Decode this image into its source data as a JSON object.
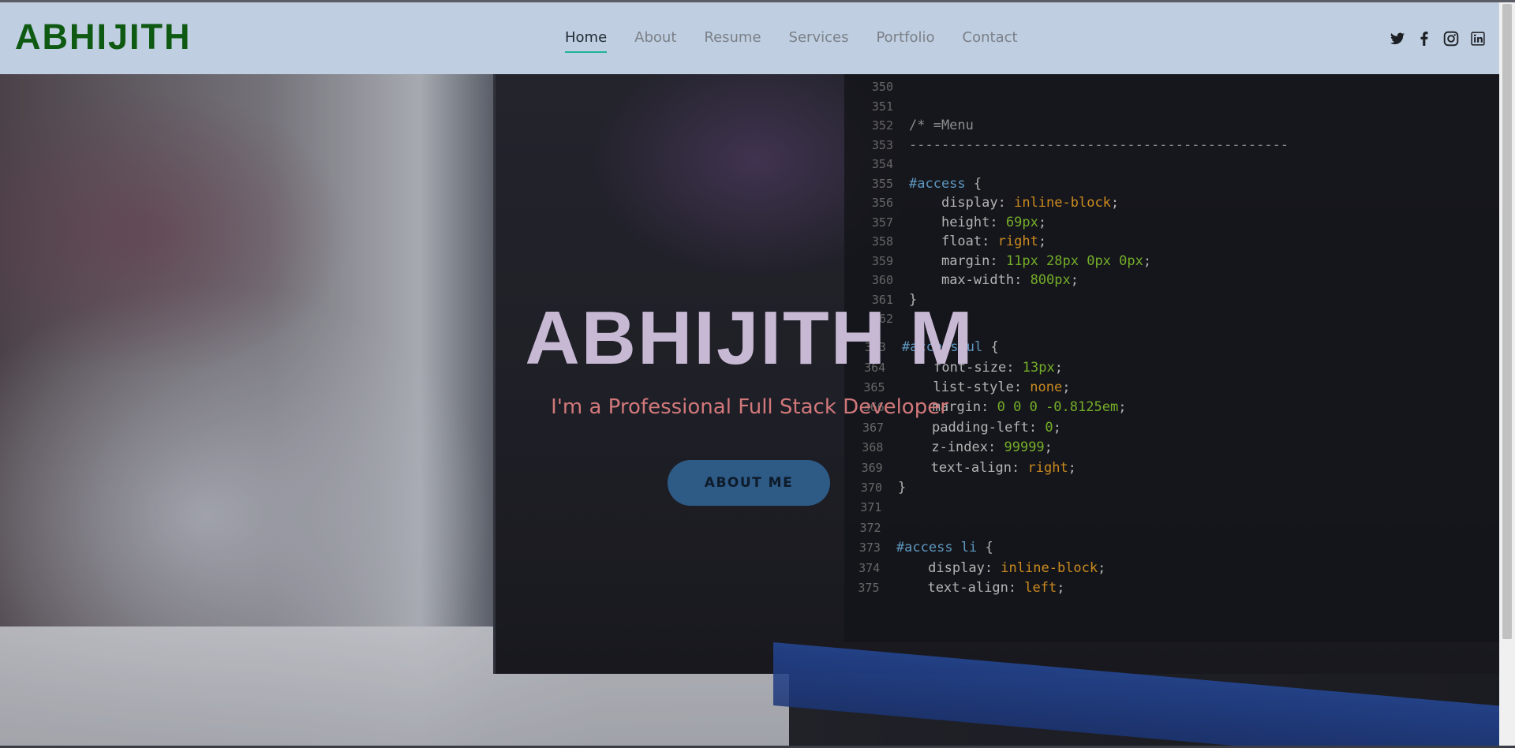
{
  "header": {
    "logo": "ABHIJITH",
    "nav": [
      {
        "label": "Home",
        "active": true
      },
      {
        "label": "About",
        "active": false
      },
      {
        "label": "Resume",
        "active": false
      },
      {
        "label": "Services",
        "active": false
      },
      {
        "label": "Portfolio",
        "active": false
      },
      {
        "label": "Contact",
        "active": false
      }
    ],
    "social_icons": [
      "twitter-icon",
      "facebook-icon",
      "instagram-icon",
      "linkedin-icon"
    ]
  },
  "hero": {
    "title": "ABHIJITH M",
    "subtitle": "I'm a Professional Full Stack Developer",
    "button_label": "ABOUT ME"
  },
  "colors": {
    "header_bg": "#bfcee0",
    "logo": "#0f5a12",
    "nav_active_underline": "#1fb39a",
    "hero_title": "#c7b8d4",
    "hero_subtitle": "#d1787a",
    "button_bg": "#2e5a86"
  },
  "background_code": {
    "lines": [
      {
        "n": "350",
        "html": ""
      },
      {
        "n": "351",
        "html": ""
      },
      {
        "n": "352",
        "html": "<span class='cmt'>/* =Menu</span>"
      },
      {
        "n": "353",
        "html": "<span class='cmt'>-----------------------------------------------</span>"
      },
      {
        "n": "354",
        "html": ""
      },
      {
        "n": "355",
        "html": "<span class='sel'>#access</span> {"
      },
      {
        "n": "356",
        "html": "&nbsp;&nbsp;&nbsp;&nbsp;<span class='prop'>display</span>: <span class='val-o'>inline-block</span>;"
      },
      {
        "n": "357",
        "html": "&nbsp;&nbsp;&nbsp;&nbsp;<span class='prop'>height</span>: <span class='val-g'>69px</span>;"
      },
      {
        "n": "358",
        "html": "&nbsp;&nbsp;&nbsp;&nbsp;<span class='prop'>float</span>: <span class='val-o'>right</span>;"
      },
      {
        "n": "359",
        "html": "&nbsp;&nbsp;&nbsp;&nbsp;<span class='prop'>margin</span>: <span class='val-g'>11px 28px 0px 0px</span>;"
      },
      {
        "n": "360",
        "html": "&nbsp;&nbsp;&nbsp;&nbsp;<span class='prop'>max-width</span>: <span class='val-g'>800px</span>;"
      },
      {
        "n": "361",
        "html": "}"
      },
      {
        "n": "362",
        "html": ""
      },
      {
        "n": "363",
        "html": "<span class='sel'>#access ul</span> {"
      },
      {
        "n": "364",
        "html": "&nbsp;&nbsp;&nbsp;&nbsp;<span class='prop'>font-size</span>: <span class='val-g'>13px</span>;"
      },
      {
        "n": "365",
        "html": "&nbsp;&nbsp;&nbsp;&nbsp;<span class='prop'>list-style</span>: <span class='val-o'>none</span>;"
      },
      {
        "n": "366",
        "html": "&nbsp;&nbsp;&nbsp;&nbsp;<span class='prop'>margin</span>: <span class='val-g'>0 0 0 -0.8125em</span>;"
      },
      {
        "n": "367",
        "html": "&nbsp;&nbsp;&nbsp;&nbsp;<span class='prop'>padding-left</span>: <span class='val-g'>0</span>;"
      },
      {
        "n": "368",
        "html": "&nbsp;&nbsp;&nbsp;&nbsp;<span class='prop'>z-index</span>: <span class='val-g'>99999</span>;"
      },
      {
        "n": "369",
        "html": "&nbsp;&nbsp;&nbsp;&nbsp;<span class='prop'>text-align</span>: <span class='val-o'>right</span>;"
      },
      {
        "n": "370",
        "html": "}"
      },
      {
        "n": "371",
        "html": ""
      },
      {
        "n": "372",
        "html": ""
      },
      {
        "n": "373",
        "html": "<span class='sel'>#access li</span> {"
      },
      {
        "n": "374",
        "html": "&nbsp;&nbsp;&nbsp;&nbsp;<span class='prop'>display</span>: <span class='val-o'>inline-block</span>;"
      },
      {
        "n": "375",
        "html": "&nbsp;&nbsp;&nbsp;&nbsp;<span class='prop'>text-align</span>: <span class='val-o'>left</span>;"
      }
    ]
  }
}
